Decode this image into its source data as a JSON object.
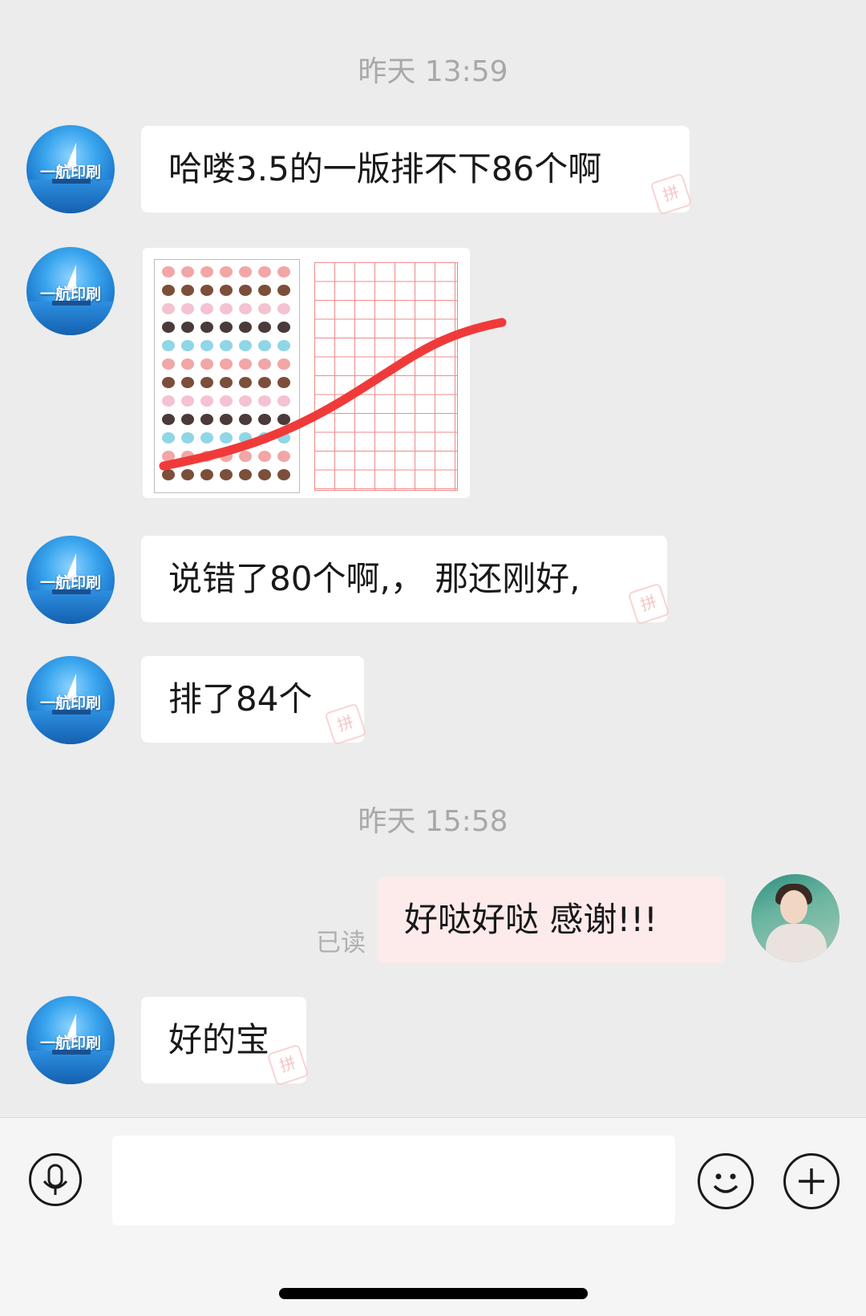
{
  "conversation": {
    "timestamps": [
      "昨天 13:59",
      "昨天 15:58"
    ],
    "contact_avatar_brand": "一航印刷",
    "messages": [
      {
        "from": "them",
        "text": "哈喽3.5的一版排不下86个啊"
      },
      {
        "from": "them",
        "type": "image"
      },
      {
        "from": "them",
        "text": "说错了80个啊,， 那还刚好,"
      },
      {
        "from": "them",
        "text": "排了84个"
      },
      {
        "from": "me",
        "text": "好哒好哒 感谢!!!",
        "status": "已读"
      },
      {
        "from": "them",
        "text": "好的宝"
      }
    ],
    "bubble_stamp": "拼"
  },
  "input_bar": {
    "voice_icon": "microphone-icon",
    "emoji_icon": "smiley-icon",
    "more_icon": "plus-icon",
    "text_value": ""
  },
  "colors": {
    "background": "#ececec",
    "their_bubble": "#ffffff",
    "my_bubble": "#fdeaea",
    "scribble": "#f03a3a"
  }
}
